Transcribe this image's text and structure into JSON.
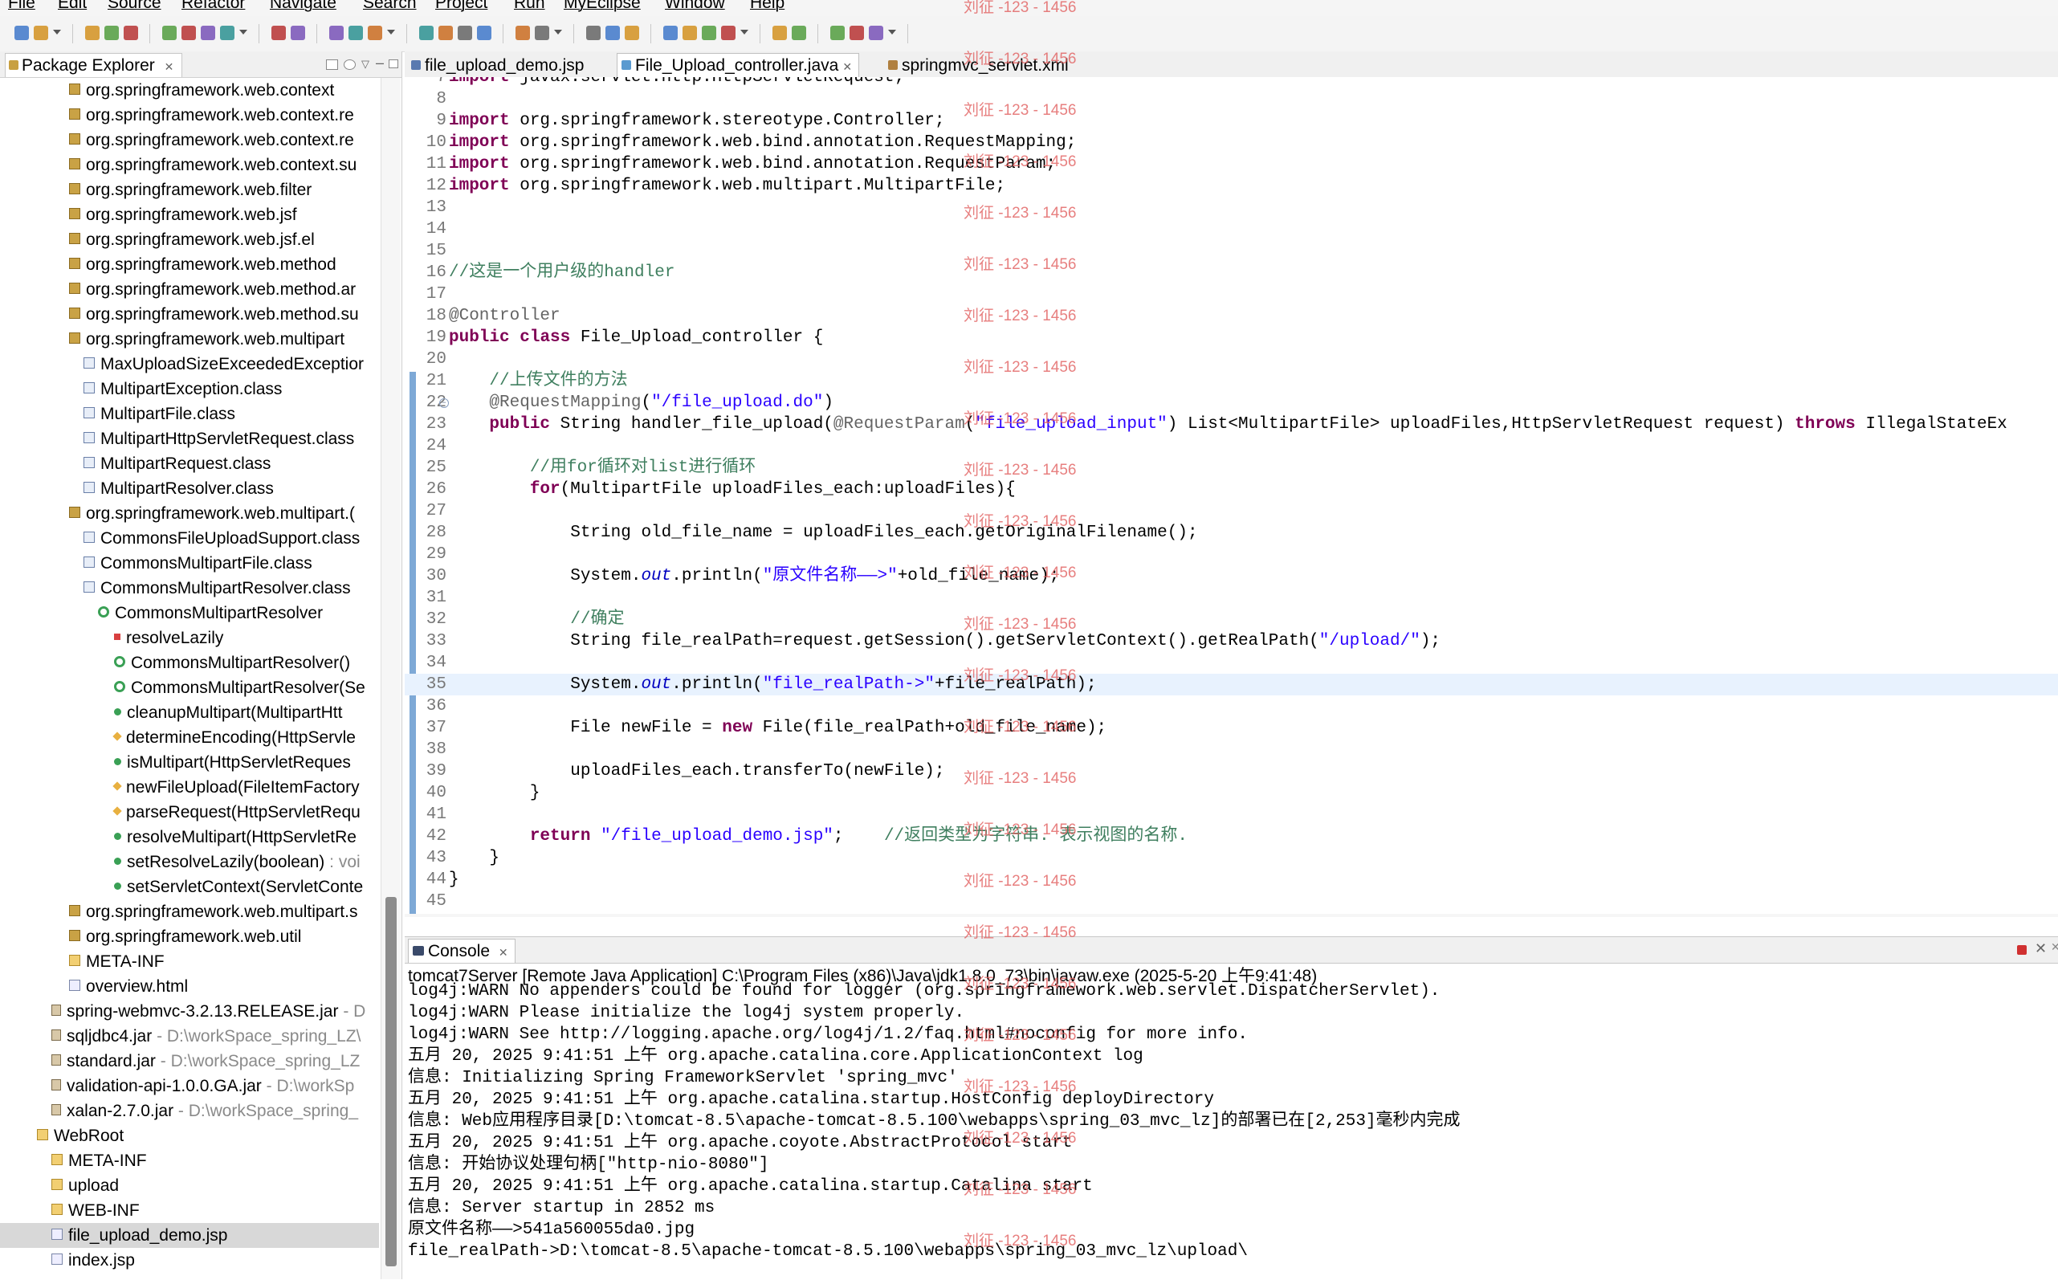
{
  "menu": [
    "File",
    "Edit",
    "Source",
    "Refactor",
    "Navigate",
    "Search",
    "Project",
    "Run",
    "MyEclipse",
    "Window",
    "Help"
  ],
  "package_explorer": {
    "title": "Package Explorer",
    "items": [
      {
        "label": "org.springframework.web.context",
        "icon": "package-icon",
        "indent": 1
      },
      {
        "label": "org.springframework.web.context.re",
        "icon": "package-icon",
        "indent": 1
      },
      {
        "label": "org.springframework.web.context.re",
        "icon": "package-icon",
        "indent": 1
      },
      {
        "label": "org.springframework.web.context.su",
        "icon": "package-icon",
        "indent": 1
      },
      {
        "label": "org.springframework.web.filter",
        "icon": "package-icon",
        "indent": 1
      },
      {
        "label": "org.springframework.web.jsf",
        "icon": "package-icon",
        "indent": 1
      },
      {
        "label": "org.springframework.web.jsf.el",
        "icon": "package-icon",
        "indent": 1
      },
      {
        "label": "org.springframework.web.method",
        "icon": "package-icon",
        "indent": 1
      },
      {
        "label": "org.springframework.web.method.ar",
        "icon": "package-icon",
        "indent": 1
      },
      {
        "label": "org.springframework.web.method.su",
        "icon": "package-icon",
        "indent": 1
      },
      {
        "label": "org.springframework.web.multipart",
        "icon": "package-icon",
        "indent": 1
      },
      {
        "label": "MaxUploadSizeExceededExceptior",
        "icon": "class-file-icon",
        "indent": 2
      },
      {
        "label": "MultipartException.class",
        "icon": "class-file-icon",
        "indent": 2
      },
      {
        "label": "MultipartFile.class",
        "icon": "class-file-icon",
        "indent": 2
      },
      {
        "label": "MultipartHttpServletRequest.class",
        "icon": "class-file-icon",
        "indent": 2
      },
      {
        "label": "MultipartRequest.class",
        "icon": "class-file-icon",
        "indent": 2
      },
      {
        "label": "MultipartResolver.class",
        "icon": "class-file-icon",
        "indent": 2
      },
      {
        "label": "org.springframework.web.multipart.(",
        "icon": "package-icon",
        "indent": 1
      },
      {
        "label": "CommonsFileUploadSupport.class",
        "icon": "class-file-icon",
        "indent": 2
      },
      {
        "label": "CommonsMultipartFile.class",
        "icon": "class-file-icon",
        "indent": 2
      },
      {
        "label": "CommonsMultipartResolver.class",
        "icon": "class-file-icon",
        "indent": 2
      },
      {
        "label": "CommonsMultipartResolver",
        "icon": "class-icon",
        "indent": 3
      },
      {
        "label": "resolveLazily",
        "icon": "private-field-icon",
        "indent": 4
      },
      {
        "label": "CommonsMultipartResolver()",
        "icon": "constructor-icon",
        "indent": 4
      },
      {
        "label": "CommonsMultipartResolver(Se",
        "icon": "constructor-icon",
        "indent": 4
      },
      {
        "label": "cleanupMultipart(MultipartHtt",
        "icon": "public-method-icon",
        "indent": 4
      },
      {
        "label": "determineEncoding(HttpServle",
        "icon": "protected-method-icon",
        "indent": 4
      },
      {
        "label": "isMultipart(HttpServletReques",
        "icon": "public-method-icon",
        "indent": 4
      },
      {
        "label": "newFileUpload(FileItemFactory",
        "icon": "protected-method-icon",
        "indent": 4
      },
      {
        "label": "parseRequest(HttpServletRequ",
        "icon": "protected-method-icon",
        "indent": 4
      },
      {
        "label": "resolveMultipart(HttpServletRe",
        "icon": "public-method-icon",
        "indent": 4
      },
      {
        "label": "setResolveLazily(boolean)",
        "suffix": " : voi",
        "icon": "public-method-icon",
        "indent": 4
      },
      {
        "label": "setServletContext(ServletConte",
        "icon": "public-method-icon",
        "indent": 4
      },
      {
        "label": "org.springframework.web.multipart.s",
        "icon": "package-icon",
        "indent": 1
      },
      {
        "label": "org.springframework.web.util",
        "icon": "package-icon",
        "indent": 1
      },
      {
        "label": "META-INF",
        "icon": "folder-icon",
        "indent": 1
      },
      {
        "label": "overview.html",
        "icon": "html-file-icon",
        "indent": 1
      },
      {
        "label": "spring-webmvc-3.2.13.RELEASE.jar",
        "suffix": " - D",
        "icon": "jar-icon",
        "indent": 0
      },
      {
        "label": "sqljdbc4.jar",
        "suffix": " - D:\\workSpace_spring_LZ\\",
        "icon": "jar-icon",
        "indent": 0
      },
      {
        "label": "standard.jar",
        "suffix": " - D:\\workSpace_spring_LZ",
        "icon": "jar-icon",
        "indent": 0
      },
      {
        "label": "validation-api-1.0.0.GA.jar",
        "suffix": " - D:\\workSp",
        "icon": "jar-icon",
        "indent": 0
      },
      {
        "label": "xalan-2.7.0.jar",
        "suffix": " - D:\\workSpace_spring_",
        "icon": "jar-icon",
        "indent": 0
      },
      {
        "label": "WebRoot",
        "icon": "folder-icon",
        "indent": -1
      },
      {
        "label": "META-INF",
        "icon": "folder-icon",
        "indent": 0
      },
      {
        "label": "upload",
        "icon": "folder-icon",
        "indent": 0
      },
      {
        "label": "WEB-INF",
        "icon": "folder-icon",
        "indent": 0
      },
      {
        "label": "file_upload_demo.jsp",
        "icon": "jsp-file-icon",
        "indent": 0,
        "selected": true
      },
      {
        "label": "index.jsp",
        "icon": "jsp-file-icon",
        "indent": 0
      }
    ]
  },
  "editor": {
    "tabs": [
      {
        "label": "file_upload_demo.jsp",
        "active": false,
        "color": "#5a7ab0"
      },
      {
        "label": "File_Upload_controller.java",
        "active": true,
        "color": "#5a9ad0"
      },
      {
        "label": "springmvc_servlet.xml",
        "active": false,
        "color": "#b08040"
      }
    ],
    "lines": [
      {
        "n": "7",
        "html": "<span class=\"kw\">import</span> javax.servlet.http.HttpServletRequest;"
      },
      {
        "n": "8",
        "html": ""
      },
      {
        "n": "9",
        "html": "<span class=\"kw\">import</span> org.springframework.stereotype.Controller;"
      },
      {
        "n": "10",
        "html": "<span class=\"kw\">import</span> org.springframework.web.bind.annotation.RequestMapping;"
      },
      {
        "n": "11",
        "html": "<span class=\"kw\">import</span> org.springframework.web.bind.annotation.RequestParam;"
      },
      {
        "n": "12",
        "html": "<span class=\"kw\">import</span> org.springframework.web.multipart.MultipartFile;"
      },
      {
        "n": "13",
        "html": ""
      },
      {
        "n": "14",
        "html": ""
      },
      {
        "n": "15",
        "html": ""
      },
      {
        "n": "16",
        "html": "<span class=\"cm\">//这是一个用户级的handler</span>"
      },
      {
        "n": "17",
        "html": ""
      },
      {
        "n": "18",
        "html": "<span class=\"an\">@Controller</span>"
      },
      {
        "n": "19",
        "html": "<span class=\"kw\">public</span> <span class=\"kw\">class</span> File_Upload_controller {"
      },
      {
        "n": "20",
        "html": ""
      },
      {
        "n": "21",
        "html": "    <span class=\"cm\">//上传文件的方法</span>"
      },
      {
        "n": "22",
        "html": "    <span class=\"an\">@RequestMapping</span>(<span class=\"st\">\"/file_upload.do\"</span>)",
        "fold": true
      },
      {
        "n": "23",
        "html": "    <span class=\"kw\">public</span> String handler_file_upload(<span class=\"an\">@RequestParam</span>(<span class=\"st\">\"file_upload_input\"</span>) List&lt;MultipartFile&gt; uploadFiles,HttpServletRequest request) <span class=\"kw\">throws</span> IllegalStateEx"
      },
      {
        "n": "24",
        "html": ""
      },
      {
        "n": "25",
        "html": "        <span class=\"cm\">//用for循环对list进行循环</span>"
      },
      {
        "n": "26",
        "html": "        <span class=\"kw\">for</span>(MultipartFile uploadFiles_each:uploadFiles){"
      },
      {
        "n": "27",
        "html": ""
      },
      {
        "n": "28",
        "html": "            String old_file_name = uploadFiles_each.getOriginalFilename();"
      },
      {
        "n": "29",
        "html": ""
      },
      {
        "n": "30",
        "html": "            System.<span class=\"fd\">out</span>.println(<span class=\"st\">\"原文件名称——&gt;\"</span>+old_file_name);"
      },
      {
        "n": "31",
        "html": ""
      },
      {
        "n": "32",
        "html": "            <span class=\"cm\">//确定</span>"
      },
      {
        "n": "33",
        "html": "            String file_realPath=request.getSession().getServletContext().getRealPath(<span class=\"st\">\"/upload/\"</span>);"
      },
      {
        "n": "34",
        "html": ""
      },
      {
        "n": "35",
        "html": "            System.<span class=\"fd\">out</span>.println(<span class=\"st\">\"file_realPath-&gt;\"</span>+file_realPath);",
        "current": true
      },
      {
        "n": "36",
        "html": ""
      },
      {
        "n": "37",
        "html": "            File newFile = <span class=\"kw\">new</span> File(file_realPath+old_file_name);"
      },
      {
        "n": "38",
        "html": ""
      },
      {
        "n": "39",
        "html": "            uploadFiles_each.transferTo(newFile);"
      },
      {
        "n": "40",
        "html": "        }"
      },
      {
        "n": "41",
        "html": ""
      },
      {
        "n": "42",
        "html": "        <span class=\"kw\">return</span> <span class=\"st\">\"/file_upload_demo.jsp\"</span>;    <span class=\"cm\">//返回类型为字符串. 表示视图的名称.</span>"
      },
      {
        "n": "43",
        "html": "    }"
      },
      {
        "n": "44",
        "html": "}"
      },
      {
        "n": "45",
        "html": ""
      }
    ]
  },
  "console": {
    "tab_label": "Console",
    "status": "tomcat7Server [Remote Java Application] C:\\Program Files (x86)\\Java\\jdk1.8.0_73\\bin\\javaw.exe (2025-5-20 上午9:41:48)",
    "lines": [
      {
        "text": "log4j:WARN No appenders could be found for logger (org.springframework.web.servlet.DispatcherServlet).",
        "red": false
      },
      {
        "text": "log4j:WARN Please initialize the log4j system properly.",
        "red": false
      },
      {
        "text": "log4j:WARN See http://logging.apache.org/log4j/1.2/faq.html#noconfig for more info.",
        "red": false
      },
      {
        "text": "五月 20, 2025 9:41:51 上午 org.apache.catalina.core.ApplicationContext log",
        "red": false
      },
      {
        "text": "信息: Initializing Spring FrameworkServlet 'spring_mvc'",
        "red": false
      },
      {
        "text": "五月 20, 2025 9:41:51 上午 org.apache.catalina.startup.HostConfig deployDirectory",
        "red": false
      },
      {
        "text": "信息: Web应用程序目录[D:\\tomcat-8.5\\apache-tomcat-8.5.100\\webapps\\spring_03_mvc_lz]的部署已在[2,253]毫秒内完成",
        "red": false
      },
      {
        "text": "五月 20, 2025 9:41:51 上午 org.apache.coyote.AbstractProtocol start",
        "red": false
      },
      {
        "text": "信息: 开始协议处理句柄[\"http-nio-8080\"]",
        "red": false
      },
      {
        "text": "五月 20, 2025 9:41:51 上午 org.apache.catalina.startup.Catalina start",
        "red": false
      },
      {
        "text": "信息: Server startup in 2852 ms",
        "red": false
      },
      {
        "text": "原文件名称——>541a560055da0.jpg",
        "red": false
      },
      {
        "text": "file_realPath->D:\\tomcat-8.5\\apache-tomcat-8.5.100\\webapps\\spring_03_mvc_lz\\upload\\",
        "red": false
      }
    ]
  },
  "watermark_text": "刘征 -123 - 1456",
  "colors": {
    "keyword": "#7f0055",
    "comment": "#3f7f5f",
    "string": "#2a00ff",
    "watermark": "#e26060"
  }
}
